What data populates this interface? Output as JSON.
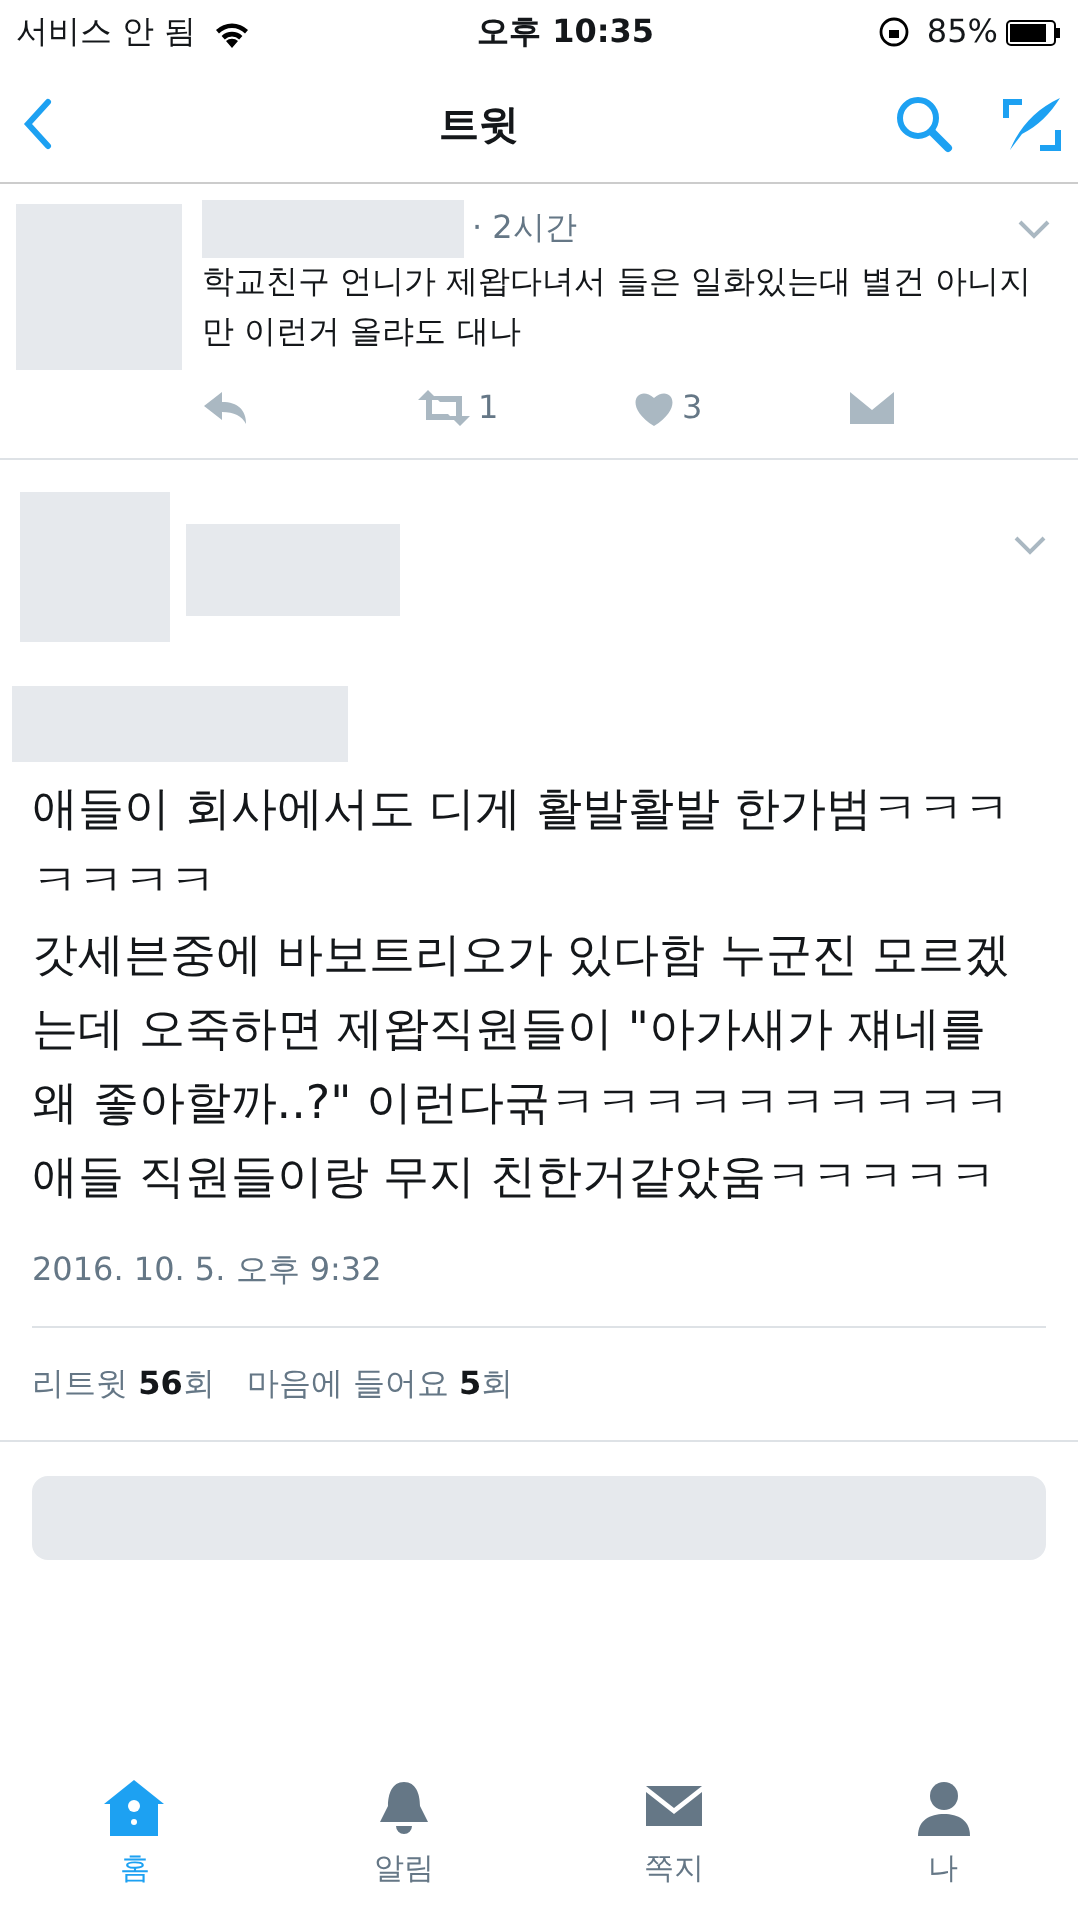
{
  "status_bar": {
    "carrier": "서비스 안 됨",
    "time": "오후 10:35",
    "battery": "85%"
  },
  "nav": {
    "title": "트윗"
  },
  "reply_tweet": {
    "time": "· 2시간",
    "text": "학교친구 언니가 제왑다녀서 들은 일화있는대 별건 아니지만 이런거 올랴도 대나",
    "retweets": "1",
    "likes": "3"
  },
  "main_tweet": {
    "paragraphs": [
      "애들이 회사에서도 디게 활발활발 한가범ㅋㅋㅋㅋㅋㅋㅋ",
      "갓세븐중에 바보트리오가 있다함 누군진 모르겠는데 오죽하면 제왑직원들이 \"아가새가 쟤네를 왜 좋아할까..?\" 이런다굮ㅋㅋㅋㅋㅋㅋㅋㅋㅋㅋ",
      "애들 직원들이랑 무지 친한거같았움ㅋㅋㅋㅋㅋ"
    ],
    "date": "2016. 10. 5. 오후 9:32",
    "stats": [
      "리트윗 **56**회",
      "마음에 들어요 **5**회"
    ]
  },
  "tab_bar": [
    {
      "label": "홈",
      "kind": "home",
      "selected": true
    },
    {
      "label": "알림",
      "kind": "bell",
      "selected": false
    },
    {
      "label": "쪽지",
      "kind": "mail",
      "selected": false
    },
    {
      "label": "나",
      "kind": "person",
      "selected": false
    }
  ]
}
